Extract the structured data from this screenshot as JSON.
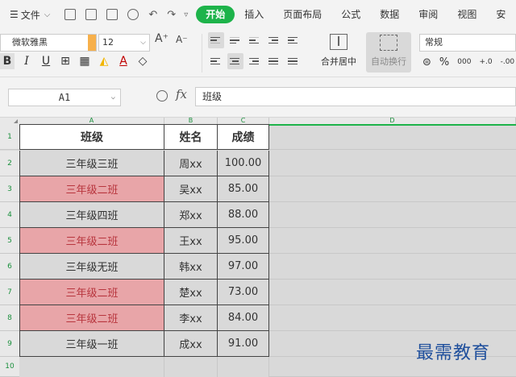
{
  "menubar": {
    "file_label": "文件",
    "tabs": [
      {
        "label": "开始",
        "active": true
      },
      {
        "label": "插入"
      },
      {
        "label": "页面布局"
      },
      {
        "label": "公式"
      },
      {
        "label": "数据"
      },
      {
        "label": "审阅"
      },
      {
        "label": "视图"
      },
      {
        "label": "安"
      }
    ]
  },
  "ribbon": {
    "font_name": "微软雅黑",
    "font_size": "12",
    "merge_label": "合并居中",
    "wrap_label": "自动换行",
    "number_format": "常规",
    "percent_symbol": "%",
    "thousands_symbol": "000",
    "inc_decimal": "+.0",
    "dec_decimal": "-.00",
    "grow_symbol": "A⁺",
    "shrink_symbol": "A⁻"
  },
  "formula_bar": {
    "cell_ref": "A1",
    "fx_label": "fx",
    "content": "班级"
  },
  "sheet": {
    "columns": [
      "A",
      "B",
      "C",
      "D"
    ],
    "rows": [
      "1",
      "2",
      "3",
      "4",
      "5",
      "6",
      "7",
      "8",
      "9",
      "10"
    ],
    "header": [
      "班级",
      "姓名",
      "成绩"
    ],
    "data": [
      {
        "class": "三年级三班",
        "name": "周xx",
        "score": "100.00",
        "highlight": false
      },
      {
        "class": "三年级二班",
        "name": "吴xx",
        "score": "85.00",
        "highlight": true
      },
      {
        "class": "三年级四班",
        "name": "郑xx",
        "score": "88.00",
        "highlight": false
      },
      {
        "class": "三年级二班",
        "name": "王xx",
        "score": "95.00",
        "highlight": true
      },
      {
        "class": "三年级无班",
        "name": "韩xx",
        "score": "97.00",
        "highlight": false
      },
      {
        "class": "三年级二班",
        "name": "楚xx",
        "score": "73.00",
        "highlight": true
      },
      {
        "class": "三年级二班",
        "name": "李xx",
        "score": "84.00",
        "highlight": true
      },
      {
        "class": "三年级一班",
        "name": "成xx",
        "score": "91.00",
        "highlight": false
      }
    ]
  },
  "watermark": "最需教育",
  "colors": {
    "accent": "#1db34a",
    "highlight_fill": "#e8a5a8",
    "highlight_text": "#b8363e"
  }
}
